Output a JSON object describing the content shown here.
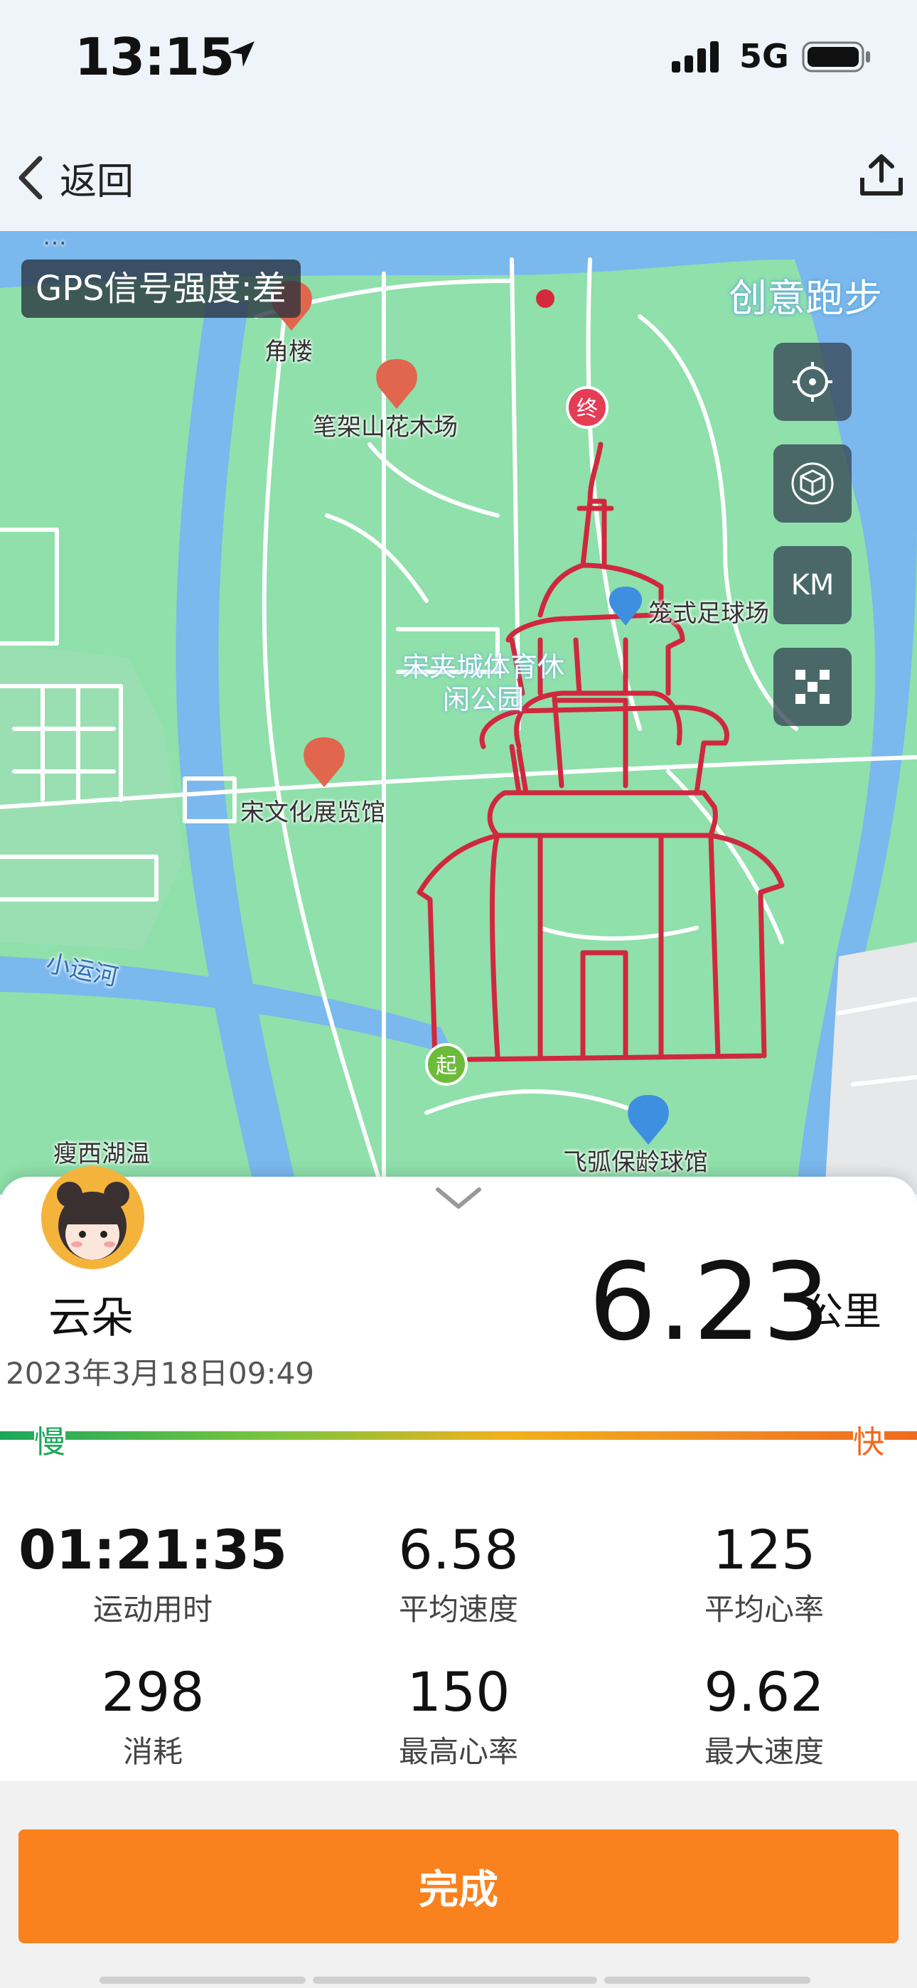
{
  "status_bar": {
    "time": "13:15",
    "network": "5G",
    "icons": [
      "location-arrow-icon",
      "signal-bars-icon",
      "battery-icon"
    ]
  },
  "nav": {
    "back_label": "返回",
    "back_icon": "chevron-left-icon",
    "share_icon": "share-upload-icon"
  },
  "map": {
    "gps_signal": "GPS信号强度:差",
    "mode_label": "创意跑步",
    "controls": {
      "locate_icon": "crosshair-icon",
      "view3d_icon": "3d-cube-icon",
      "km_label": "KM",
      "fullscreen_icon": "expand-icon"
    },
    "start_marker": "起",
    "end_marker": "终",
    "places": [
      "角楼",
      "笔架山花木场",
      "宋夹城体育休闲公园",
      "宋文化展览馆",
      "小运河",
      "瘦西湖温",
      "飞弧保龄球馆",
      "笼式足球场"
    ],
    "colors": {
      "park": "#8fe0ab",
      "water": "#7ab8ee",
      "route": "#d0283e"
    }
  },
  "summary": {
    "username": "云朵",
    "datetime": "2023年3月18日09:49",
    "distance": "6.23",
    "distance_unit": "公里",
    "speed_slow": "慢",
    "speed_fast": "快",
    "stats": [
      {
        "value": "01:21:35",
        "label": "运动用时"
      },
      {
        "value": "6.58",
        "label": "平均速度"
      },
      {
        "value": "125",
        "label": "平均心率"
      },
      {
        "value": "298",
        "label": "消耗"
      },
      {
        "value": "150",
        "label": "最高心率"
      },
      {
        "value": "9.62",
        "label": "最大速度"
      }
    ],
    "done_label": "完成",
    "accent": "#f9821e"
  }
}
